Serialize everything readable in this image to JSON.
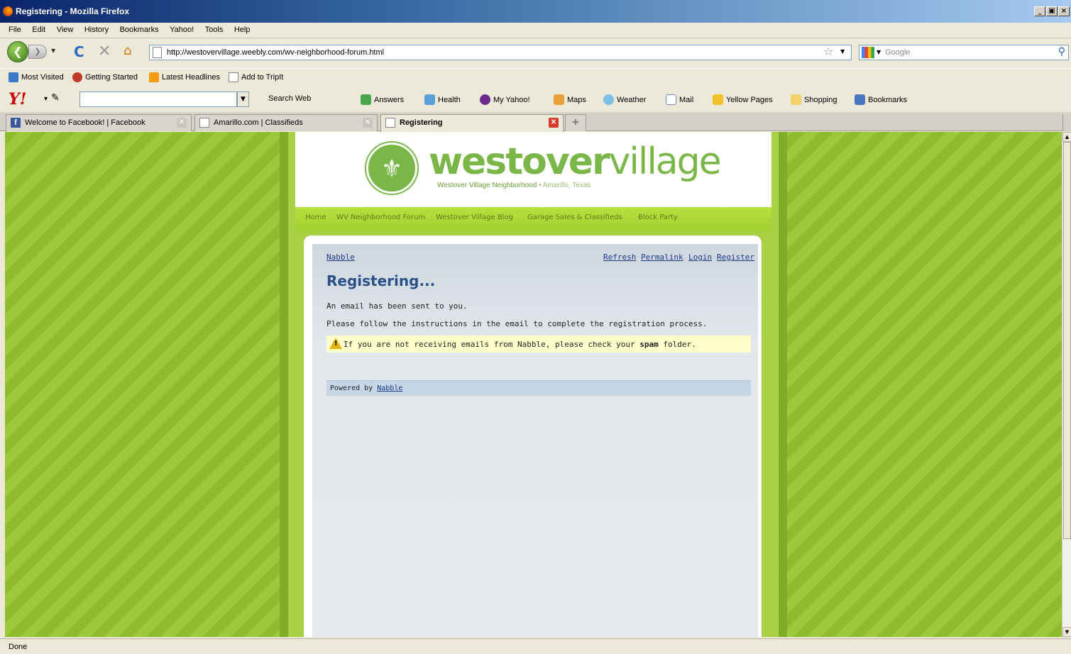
{
  "window": {
    "title": "Registering - Mozilla Firefox",
    "buttons": [
      "_",
      "×"
    ]
  },
  "menu": [
    "File",
    "Edit",
    "View",
    "History",
    "Bookmarks",
    "Yahoo!",
    "Tools",
    "Help"
  ],
  "navbar": {
    "url": "http://westovervillage.weebly.com/wv-neighborhood-forum.html",
    "search_placeholder": "Google"
  },
  "bookmarks": [
    "Most Visited",
    "Getting Started",
    "Latest Headlines",
    "Add to TripIt"
  ],
  "yahoo_toolbar": {
    "search_web": "Search Web",
    "items": [
      "Answers",
      "Health",
      "My Yahoo!",
      "Maps",
      "Weather",
      "Mail",
      "Yellow Pages",
      "Shopping",
      "Bookmarks"
    ]
  },
  "tabs": [
    {
      "label": "Welcome to Facebook! | Facebook"
    },
    {
      "label": "Amarillo.com | Classifieds"
    },
    {
      "label": "Registering"
    }
  ],
  "site": {
    "logo_bold": "westover",
    "logo_thin": "village",
    "logo_sub": "Westover Village Neighborhood",
    "logo_city": "• Amarillo, Texas",
    "nav": [
      "Home",
      "WV Neighborhood Forum",
      "Westover Village Blog",
      "Garage Sales & Classifieds",
      "Block Party"
    ]
  },
  "nabble": {
    "home_link": "Nabble",
    "links": [
      "Refresh",
      "Permalink",
      "Login",
      "Register"
    ],
    "title": "Registering...",
    "line1": "An email has been sent to you.",
    "line2": "Please follow the instructions in the email to complete the registration process.",
    "warn_pre": "If you are not receiving emails from Nabble, please check your",
    "warn_bold": "spam",
    "warn_post": "folder.",
    "powered_by": "Powered by",
    "powered_link": "Nabble"
  },
  "status": "Done",
  "colors": {
    "green_bg": "#9cc83a",
    "logo_green": "#7ab648",
    "nabble_title": "#2a5088",
    "link_blue": "#1a3a8a"
  }
}
